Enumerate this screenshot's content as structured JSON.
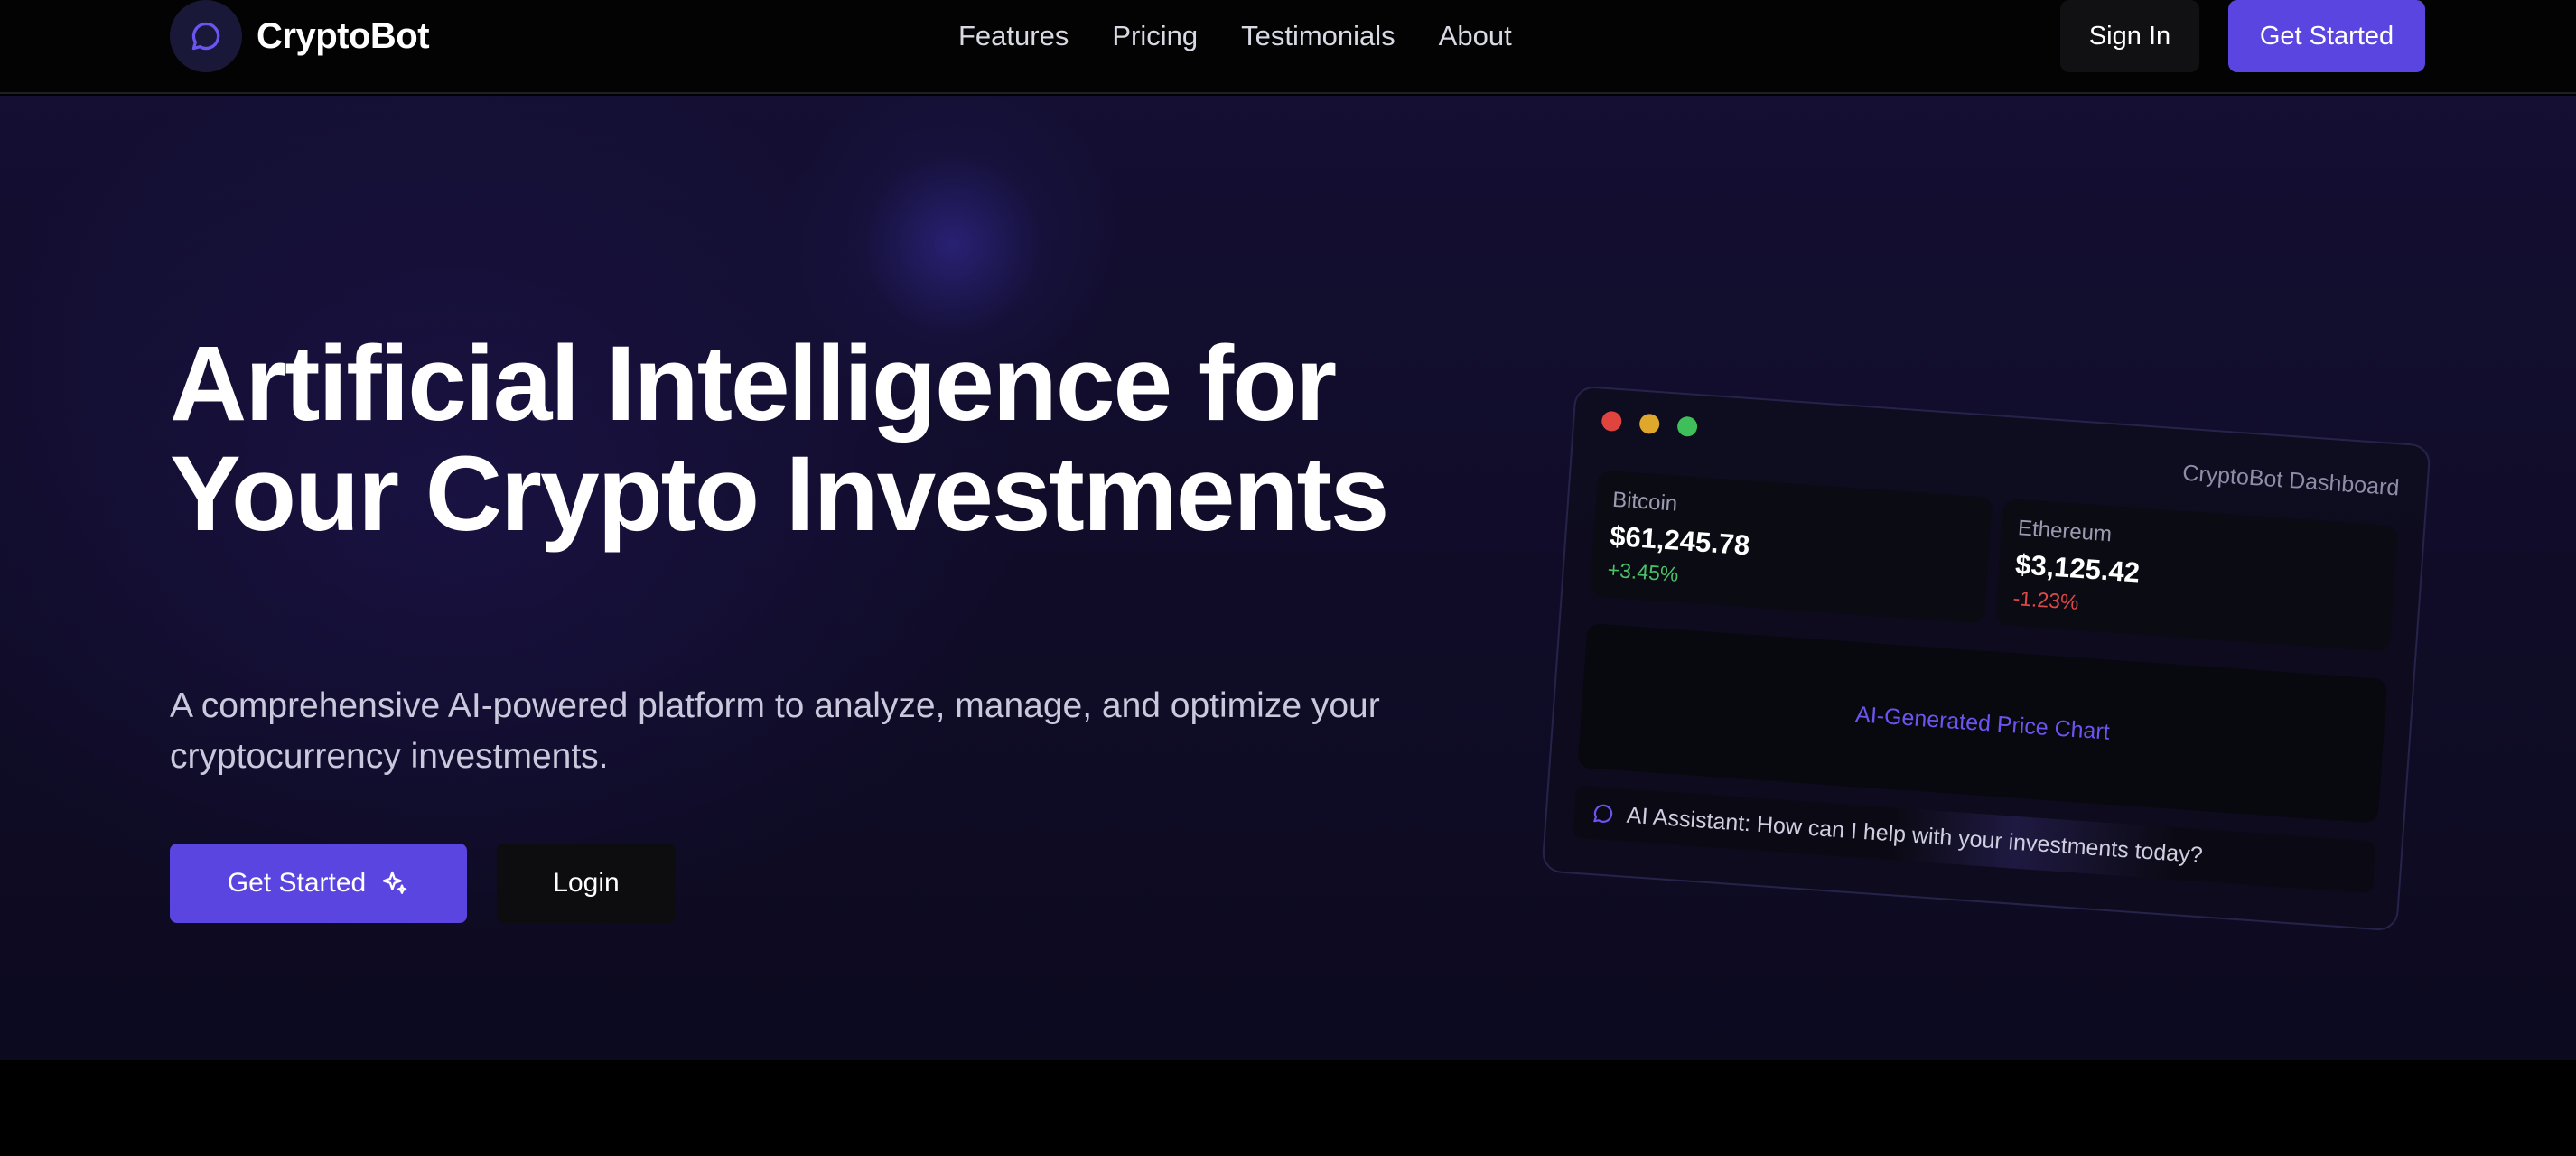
{
  "brand": {
    "name": "CryptoBot",
    "accent": "#5a45e0"
  },
  "nav": {
    "links": [
      "Features",
      "Pricing",
      "Testimonials",
      "About"
    ],
    "sign_in": "Sign In",
    "get_started": "Get Started"
  },
  "hero": {
    "title_line1": "Artificial Intelligence for",
    "title_line2": "Your Crypto Investments",
    "subtitle": "A comprehensive AI-powered platform to analyze, manage, and optimize your cryptocurrency investments.",
    "primary_button": "Get Started",
    "secondary_button": "Login"
  },
  "dashboard": {
    "title": "CryptoBot Dashboard",
    "window_dots": [
      "#e0443e",
      "#dfa72c",
      "#3fbf5a"
    ],
    "coins": [
      {
        "name": "Bitcoin",
        "price": "$61,245.78",
        "change": "+3.45%",
        "change_color": "#49c16a"
      },
      {
        "name": "Ethereum",
        "price": "$3,125.42",
        "change": "-1.23%",
        "change_color": "#e04848"
      }
    ],
    "chart_label": "AI-Generated Price Chart",
    "assistant_text": "AI Assistant: How can I help with your investments today?"
  }
}
